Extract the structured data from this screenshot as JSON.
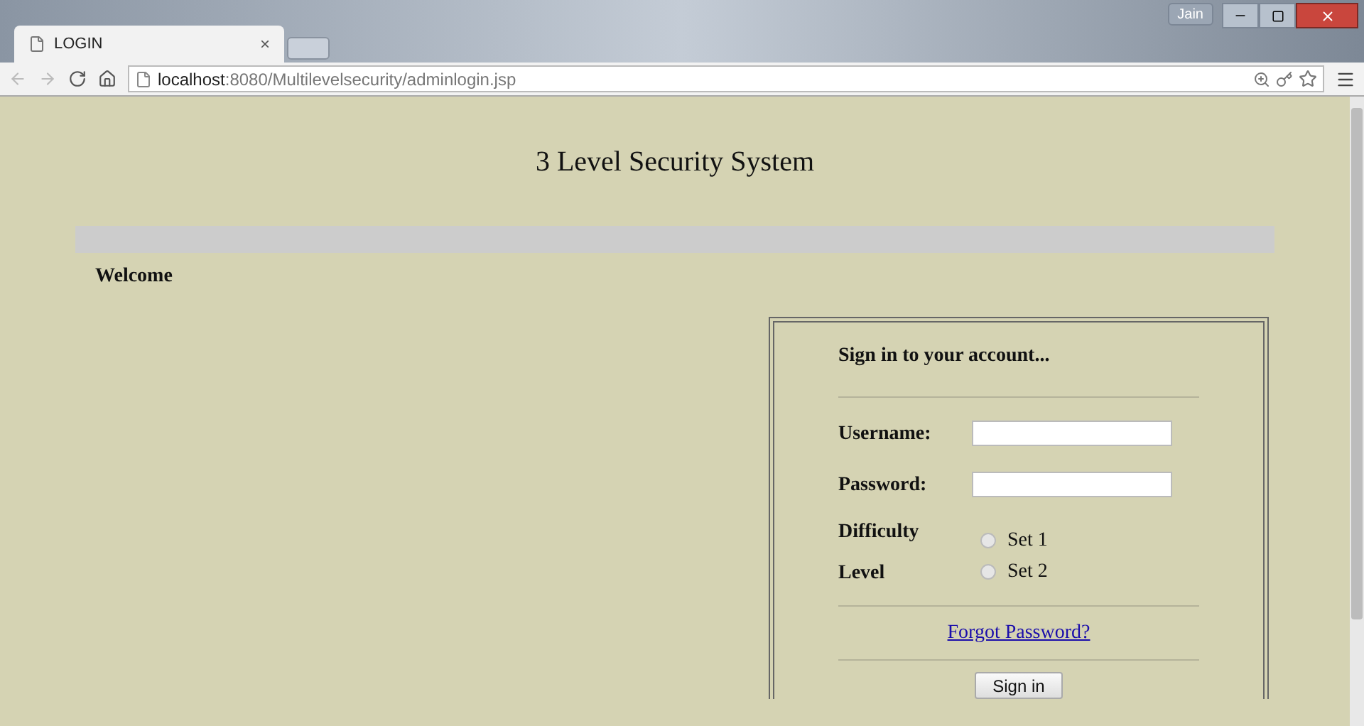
{
  "browser": {
    "tab_title": "LOGIN",
    "tab_close": "×",
    "profile": "Jain",
    "url_host": "localhost",
    "url_rest": ":8080/Multilevelsecurity/adminlogin.jsp"
  },
  "page": {
    "title": "3 Level Security System",
    "welcome": "Welcome"
  },
  "login": {
    "heading": "Sign in to your account...",
    "fields": [
      {
        "label": "Username:"
      },
      {
        "label": "Password:"
      }
    ],
    "difficulty_label": [
      "Difficulty",
      "Level"
    ],
    "options": [
      {
        "label": "Set 1",
        "selected": false
      },
      {
        "label": "Set 2",
        "selected": false
      }
    ],
    "forgot_link": "Forgot Password?",
    "submit": "Sign in"
  }
}
